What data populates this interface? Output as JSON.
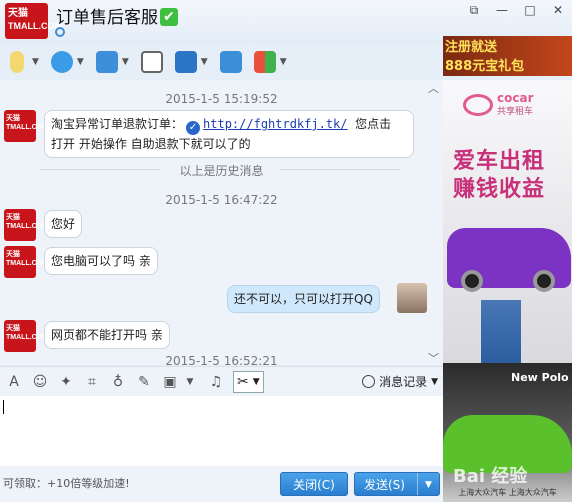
{
  "window": {
    "title": "订单售后客服",
    "avatar_text_cn": "天猫",
    "avatar_text_en": "TMALL.COM",
    "controls": [
      "restore-icon",
      "minimize-icon",
      "maximize-icon",
      "close-icon"
    ]
  },
  "toolbar": {
    "items": [
      "microphone-icon",
      "webcam-icon",
      "file-transfer-icon",
      "add-chat-icon",
      "screen-share-icon",
      "remote-assist-icon",
      "apps-grid-icon"
    ]
  },
  "chat": {
    "timestamp_1": "2015-1-5 15:19:52",
    "msg_1_prefix": "淘宝异常订单退款订单：",
    "msg_1_link": "http://fghtrdkfj.tk/",
    "msg_1_suffix": "您点击",
    "msg_1_line2": "打开 开始操作 自助退款下就可以了的",
    "history_divider": "以上是历史消息",
    "timestamp_2": "2015-1-5 16:47:22",
    "msg_2": "您好",
    "msg_3": "您电脑可以了吗 亲",
    "msg_4_me": "还不可以，只可以打开QQ",
    "msg_5": "网页都不能打开吗 亲",
    "timestamp_3": "2015-1-5 16:52:21"
  },
  "input_toolbar": {
    "items": [
      "font-icon",
      "emoji-icon",
      "magic-icon",
      "screenshot-icon",
      "voice-icon",
      "edit-icon",
      "image-icon",
      "music-icon",
      "scissors-icon"
    ],
    "history_label": "消息记录"
  },
  "bottom": {
    "hint": "可领取：+10倍等级加速!",
    "close_label": "关闭(C)",
    "send_label": "发送(S)"
  },
  "ads": {
    "banner_line1": "注册就送",
    "banner_line2": "888元宝礼包",
    "cocar_name": "cocar",
    "cocar_sub": "共享租车",
    "headline_1": "爱车出租",
    "headline_2": "赚钱收益",
    "car_brand": "New Polo",
    "car_footer": "上海大众汽车 上海大众汽车",
    "watermark": "Bai 经验"
  }
}
